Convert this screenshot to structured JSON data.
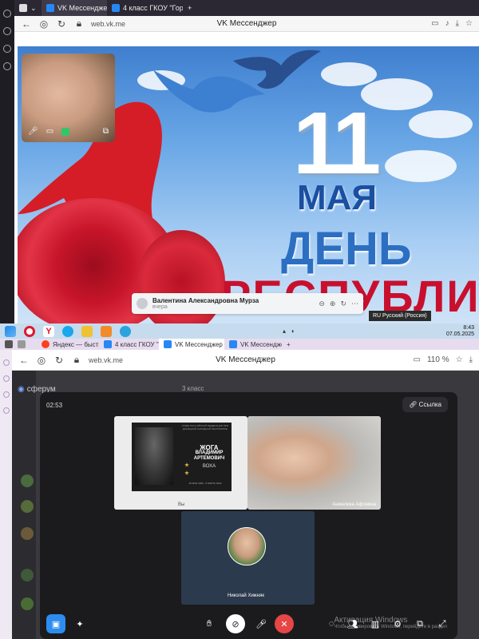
{
  "top": {
    "tabs": [
      {
        "label": "VK Мессенджер",
        "active": true
      },
      {
        "label": "4 класс ГКОУ \"Горл...",
        "active": false
      }
    ],
    "address": {
      "url": "web.vk.me",
      "title": "VK Мессенджер"
    },
    "poster": {
      "number": "11",
      "month": "МАЯ",
      "day": "ДЕНЬ",
      "republic": "РЕСПУБЛИКИ"
    },
    "notification": {
      "name": "Валентина Александровна Мурза",
      "sub": "вчера"
    },
    "taskbar": {
      "lang": "RU Русский (Россия)",
      "time": "8:43",
      "date": "07.05.2025"
    }
  },
  "bottom": {
    "tabs": [
      {
        "label": "Яндекс — быстрый пои...",
        "active": false
      },
      {
        "label": "4 класс ГКОУ \"Горловск...",
        "active": false
      },
      {
        "label": "VK Мессенджер",
        "active": true
      },
      {
        "label": "VK Мессенджер",
        "active": false
      }
    ],
    "address": {
      "url": "web.vk.me",
      "title": "VK Мессенджер",
      "zoom": "110 %"
    },
    "sidebar": {
      "title": "сферум",
      "chat_header": "3 класс"
    },
    "call": {
      "timer": "02:53",
      "link_label": "Ссылка",
      "share_label": "Вы",
      "memorial": {
        "header": "ГЛАВА РОССИЙСКОЙ ФЕДЕРАЦИИ ПРИ ДОНЕЦКОЙ НАРОДНОЙ РЕСПУБЛИКЕ",
        "surname": "ЖОГА",
        "name": "ВЛАДИМИР АРТЕМОВИЧ",
        "callsign": "ВОХА",
        "dates": "26 МАЯ 1993 - 5 МАРТА 2022"
      },
      "participants": [
        "Анжелика Афонина",
        "Николай Хижняк"
      ]
    },
    "watermark": {
      "line1": "Активация Windows",
      "line2": "Чтобы активировать Windows, перейдите в раздел"
    }
  }
}
